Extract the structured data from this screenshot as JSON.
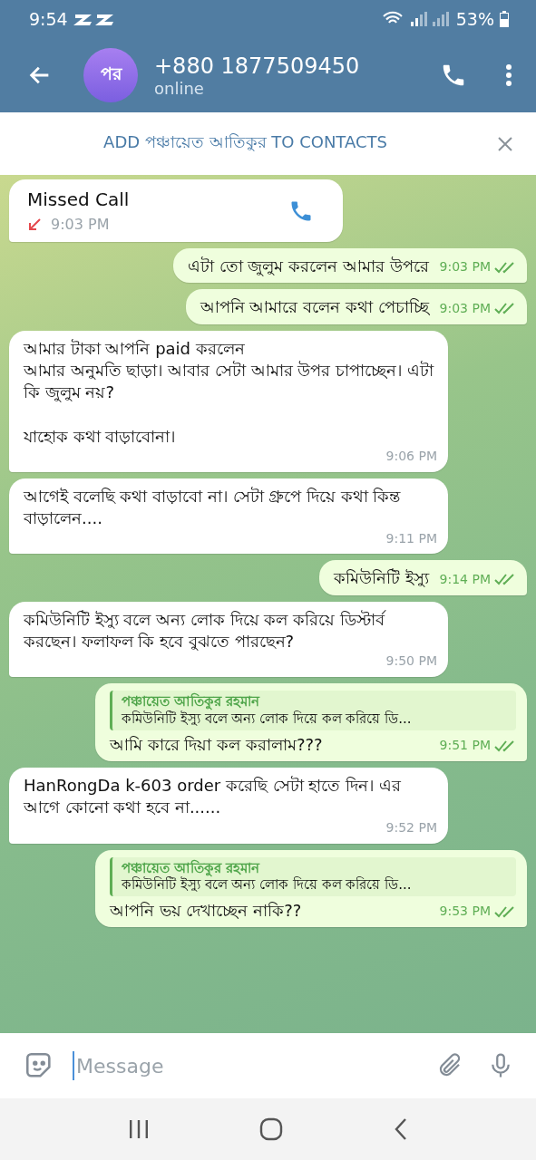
{
  "status_bar": {
    "time": "9:54",
    "battery": "53%"
  },
  "header": {
    "avatar": "পর",
    "title": "+880 1877509450",
    "subtitle": "online"
  },
  "banner": {
    "text": "ADD পঞ্চায়েত আতিকুর TO CONTACTS"
  },
  "messages": [
    {
      "kind": "call",
      "outgoing": false,
      "title": "Missed Call",
      "time": "9:03 PM"
    },
    {
      "kind": "text",
      "outgoing": true,
      "text": "এটা তো জুলুম করলেন আমার উপরে",
      "time": "9:03 PM",
      "read": true
    },
    {
      "kind": "text",
      "outgoing": true,
      "text": "আপনি আমারে বলেন কথা পেচাচ্ছি",
      "time": "9:03 PM",
      "read": true
    },
    {
      "kind": "text",
      "outgoing": false,
      "text": "আমার টাকা আপনি paid করলেন\nআমার অনুমতি ছাড়া। আবার সেটা আমার উপর চাপাচ্ছেন। এটা কি জুলুম নয়?\n\nযাহোক কথা বাড়াবোনা।",
      "time": "9:06 PM"
    },
    {
      "kind": "text",
      "outgoing": false,
      "text": "আগেই বলেছি কথা বাড়াবো না। সেটা গ্রুপে দিয়ে কথা কিন্ত বাড়ালেন....",
      "time": "9:11 PM"
    },
    {
      "kind": "text",
      "outgoing": true,
      "text": "কমিউনিটি ইস্যু",
      "time": "9:14 PM",
      "read": true
    },
    {
      "kind": "text",
      "outgoing": false,
      "text": "কমিউনিটি ইস্যু বলে অন্য লোক দিয়ে কল করিয়ে ডিস্টার্ব করছেন। ফলাফল কি হবে বুঝতে পারছেন?",
      "time": "9:50 PM"
    },
    {
      "kind": "text",
      "outgoing": true,
      "reply": {
        "name": "পঞ্চায়েত আতিকুর রহমান",
        "text": "কমিউনিটি ইস্যু বলে অন্য লোক দিয়ে কল করিয়ে ডি..."
      },
      "text": "আমি কারে দিয়া কল করালাম???",
      "time": "9:51 PM",
      "read": true
    },
    {
      "kind": "text",
      "outgoing": false,
      "text": "HanRongDa k-603 order করেছি সেটা হাতে দিন। এর আগে কোনো কথা হবে না......",
      "time": "9:52 PM"
    },
    {
      "kind": "text",
      "outgoing": true,
      "reply": {
        "name": "পঞ্চায়েত আতিকুর রহমান",
        "text": "কমিউনিটি ইস্যু বলে অন্য লোক দিয়ে কল করিয়ে ডি..."
      },
      "text": "আপনি ভয় দেখাচ্ছেন নাকি??",
      "time": "9:53 PM",
      "read": true
    }
  ],
  "composer": {
    "placeholder": "Message"
  }
}
